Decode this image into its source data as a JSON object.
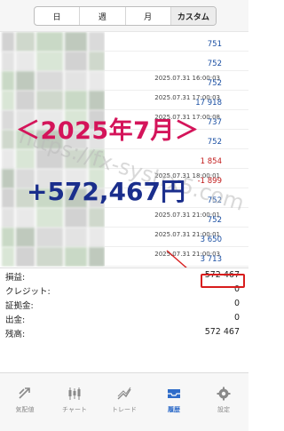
{
  "tabs": [
    {
      "label": "日",
      "active": false
    },
    {
      "label": "週",
      "active": false
    },
    {
      "label": "月",
      "active": false
    },
    {
      "label": "カスタム",
      "active": true
    }
  ],
  "entries": [
    {
      "timestamp": "",
      "amount": "751",
      "negative": false
    },
    {
      "timestamp": "",
      "amount": "752",
      "negative": false
    },
    {
      "timestamp": "2025.07.31 16:00:03",
      "amount": "752",
      "negative": false
    },
    {
      "timestamp": "2025.07.31 17:00:03",
      "amount": "17 918",
      "negative": false
    },
    {
      "timestamp": "2025.07.31 17:00:08",
      "amount": "737",
      "negative": false
    },
    {
      "timestamp": "",
      "amount": "752",
      "negative": false
    },
    {
      "timestamp": "",
      "amount": "1 854",
      "negative": true
    },
    {
      "timestamp": "2025.07.31 18:00:01",
      "amount": "-1 899",
      "negative": true
    },
    {
      "timestamp": "",
      "amount": "752",
      "negative": false
    },
    {
      "timestamp": "2025.07.31 21:00:01",
      "amount": "752",
      "negative": false
    },
    {
      "timestamp": "2025.07.31 21:00:01",
      "amount": "3 650",
      "negative": false
    },
    {
      "timestamp": "2025.07.31 21:00:03",
      "amount": "3 713",
      "negative": false
    }
  ],
  "overlay": {
    "month": "＜2025年7月＞",
    "total": "+572,467円",
    "watermark": "https://fx-systrx5.com"
  },
  "summary": [
    {
      "label": "損益:",
      "value": "572 467"
    },
    {
      "label": "クレジット:",
      "value": "0"
    },
    {
      "label": "証拠金:",
      "value": "0"
    },
    {
      "label": "出金:",
      "value": "0"
    },
    {
      "label": "残高:",
      "value": "572 467"
    }
  ],
  "nav": [
    {
      "label": "気配値",
      "icon": "quotes-icon",
      "active": false
    },
    {
      "label": "チャート",
      "icon": "chart-icon",
      "active": false
    },
    {
      "label": "トレード",
      "icon": "trade-icon",
      "active": false
    },
    {
      "label": "履歴",
      "icon": "history-icon",
      "active": true
    },
    {
      "label": "設定",
      "icon": "settings-icon",
      "active": false
    }
  ],
  "colors": {
    "positive": "#1a4fa3",
    "negative": "#c21c1c",
    "month_overlay": "#d4145a",
    "total_overlay": "#1a2e8c",
    "highlight": "#d81d1d",
    "nav_active": "#2f6cc9"
  }
}
